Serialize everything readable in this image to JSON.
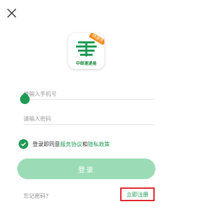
{
  "header": {
    "close_icon": "close-icon"
  },
  "logo": {
    "badge": "快递员",
    "caption": "中邮速递易",
    "brand_color": "#1f9a55"
  },
  "form": {
    "phone_placeholder": "请输入手机号",
    "password_placeholder": "请输入密码"
  },
  "agreement": {
    "prefix": "登录即同意",
    "service_link": "服务协议",
    "conjunction": "和",
    "privacy_link": "隐私政策",
    "checked": true
  },
  "actions": {
    "login_label": "登录",
    "forgot_label": "忘记密码?",
    "register_label": "立即注册"
  },
  "colors": {
    "primary": "#1f9a55",
    "button_disabled": "#9bdcb7",
    "highlight_border": "#e0282f"
  }
}
